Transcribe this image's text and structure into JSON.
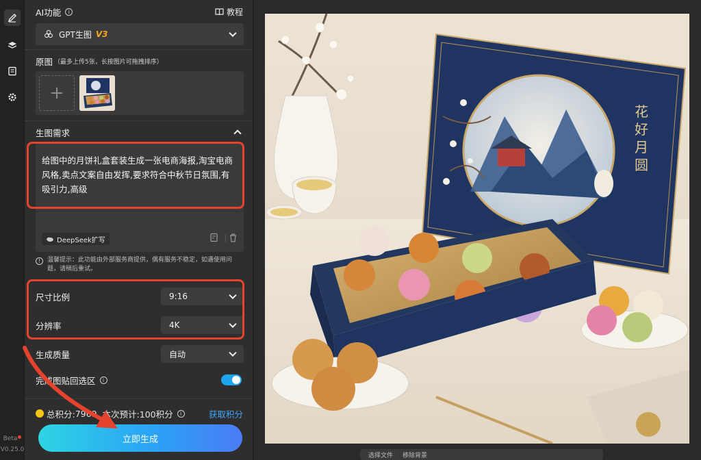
{
  "rail": {
    "version_badge": "Beta",
    "version": "V0.25.0"
  },
  "header": {
    "title": "AI功能",
    "tutorial": "教程"
  },
  "model": {
    "name": "GPT生图",
    "version": "V3"
  },
  "source": {
    "label": "原图",
    "hint": "（最多上传5张，长按图片可拖拽排序）",
    "thumb_text": "月饼礼盒"
  },
  "prompt": {
    "section_label": "生图需求",
    "text": "给图中的月饼礼盒套装生成一张电商海报,淘宝电商风格,卖点文案自由发挥,要求符合中秋节日氛围,有吸引力,高级",
    "deepseek_label": "DeepSeek扩写",
    "notice": "温馨提示：此功能由外部服务商提供，偶有服务不稳定，如遇使用问题，请稍后重试。"
  },
  "settings": {
    "ratio_label": "尺寸比例",
    "ratio_value": "9:16",
    "resolution_label": "分辨率",
    "resolution_value": "4K",
    "quality_label": "生成质量",
    "quality_value": "自动",
    "paste_label": "完成图贴回选区"
  },
  "credits": {
    "total_label": "总积分:",
    "total_value": "7969",
    "estimate": "本次预计:100积分",
    "get_label": "获取积分"
  },
  "generate_label": "立即生成",
  "canvas": {
    "box_title": "花好月圆"
  },
  "bottom_bar": {
    "item1": "选择文件",
    "item2": "移除背景"
  },
  "colors": {
    "accent": "#1ea5ee",
    "highlight": "#e5432d",
    "model_version": "#f5a623",
    "coin": "#f5c518",
    "link": "#3ea6ff"
  }
}
